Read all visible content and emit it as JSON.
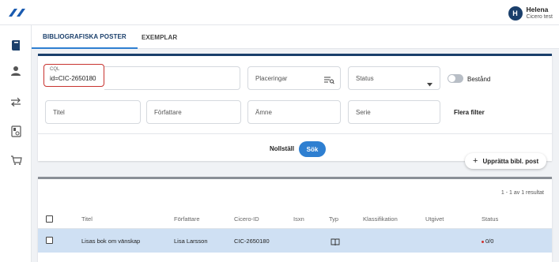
{
  "header": {
    "user": {
      "initial": "H",
      "name": "Helena",
      "subtitle": "Cicero test"
    },
    "logo_icon": "cicero-logo",
    "accent_color": "#1a3f6b"
  },
  "sidebar": {
    "items": [
      {
        "icon": "book-icon"
      },
      {
        "icon": "user-icon"
      },
      {
        "icon": "transfer-arrows-icon"
      },
      {
        "icon": "calendar-icon"
      },
      {
        "icon": "cart-icon"
      }
    ]
  },
  "tabs": [
    {
      "label": "BIBLIOGRAFISKA POSTER",
      "active": true
    },
    {
      "label": "EXEMPLAR",
      "active": false
    }
  ],
  "search": {
    "cql": {
      "label": "CQL",
      "value": "id=CIC-2650180"
    },
    "placeringar": {
      "placeholder": "Placeringar"
    },
    "status": {
      "placeholder": "Status"
    },
    "bestand": {
      "label": "Bestånd",
      "on": false
    },
    "titel": {
      "placeholder": "Titel"
    },
    "forfattare": {
      "placeholder": "Författare"
    },
    "amne": {
      "placeholder": "Ämne"
    },
    "serie": {
      "placeholder": "Serie"
    },
    "more_filters": "Flera filter",
    "reset_label": "Nollställ",
    "search_label": "Sök"
  },
  "create_button": {
    "label": "Upprätta bibl. post"
  },
  "results": {
    "count_text": "1 - 1 av 1 resultat",
    "columns": [
      "Titel",
      "Författare",
      "Cicero-ID",
      "Isxn",
      "Typ",
      "Klassifikation",
      "Utgivet",
      "Status"
    ],
    "rows": [
      {
        "titel": "Lisas bok om vänskap",
        "forfattare": "Lisa Larsson",
        "cicero_id": "CIC-2650180",
        "isxn": "",
        "typ_icon": "book-open-icon",
        "klassifikation": "",
        "utgivet": "",
        "status": "0/0",
        "status_color": "#d0312d"
      }
    ]
  }
}
